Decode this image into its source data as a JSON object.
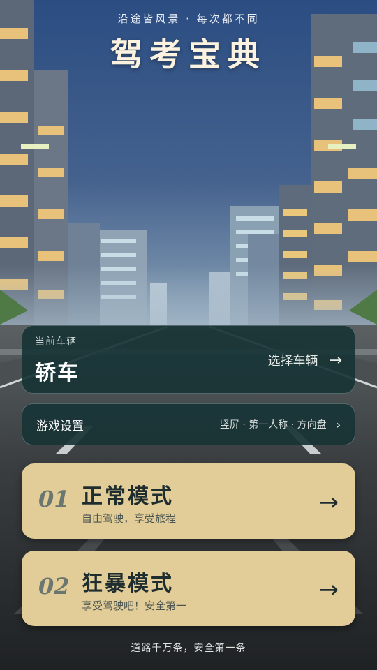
{
  "header": {
    "tagline": "沿途皆风景 · 每次都不同",
    "title": "驾考宝典"
  },
  "vehicle": {
    "label": "当前车辆",
    "name": "轿车",
    "select_label": "选择车辆",
    "select_icon": "→"
  },
  "settings": {
    "title": "游戏设置",
    "summary": "竖屏 · 第一人称 · 方向盘",
    "chevron": "›"
  },
  "modes": [
    {
      "number": "01",
      "title": "正常模式",
      "subtitle": "自由驾驶，享受旅程",
      "arrow": "→"
    },
    {
      "number": "02",
      "title": "狂暴模式",
      "subtitle": "享受驾驶吧！安全第一",
      "arrow": "→"
    }
  ],
  "footer": {
    "text": "道路千万条，安全第一条"
  },
  "colors": {
    "sky_top": "#2b4d82",
    "sky_bottom": "#7f9ab0",
    "road": "#333638",
    "card_dark": "#18343a",
    "card_light": "#e2cc98",
    "title_text": "#fbf3df"
  }
}
